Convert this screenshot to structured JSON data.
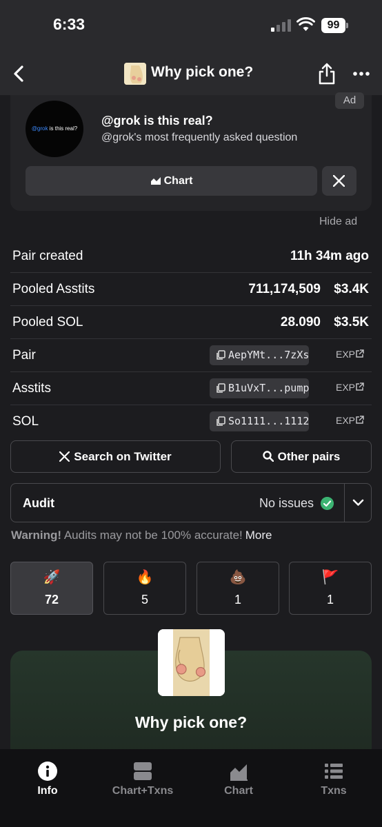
{
  "status_bar": {
    "time": "6:33",
    "battery": "99"
  },
  "header": {
    "title": "Why pick one?"
  },
  "ad": {
    "badge": "Ad",
    "logo_handle": "@grok",
    "logo_text": " is this real?",
    "title": "@grok is this real?",
    "subtitle": "@grok's most frequently asked question",
    "chart_button": "Chart",
    "hide_label": "Hide ad"
  },
  "info": {
    "pair_created": {
      "label": "Pair created",
      "value": "11h 34m ago"
    },
    "pooled_token": {
      "label": "Pooled Asstits",
      "amount": "711,174,509",
      "usd": "$3.4K"
    },
    "pooled_sol": {
      "label": "Pooled SOL",
      "amount": "28.090",
      "usd": "$3.5K"
    },
    "addresses": [
      {
        "label": "Pair",
        "address": "AepYMt...7zXs",
        "exp": "EXP"
      },
      {
        "label": "Asstits",
        "address": "B1uVxT...pump",
        "exp": "EXP"
      },
      {
        "label": "SOL",
        "address": "So1111...1112",
        "exp": "EXP"
      }
    ]
  },
  "actions": {
    "twitter": "Search on Twitter",
    "other_pairs": "Other pairs"
  },
  "audit": {
    "label": "Audit",
    "status": "No issues",
    "warning_bold": "Warning!",
    "warning_text": " Audits may not be 100% accurate!",
    "more": "More"
  },
  "votes": [
    {
      "emoji": "🚀",
      "icon": "rocket-icon",
      "count": "72"
    },
    {
      "emoji": "🔥",
      "icon": "fire-icon",
      "count": "5"
    },
    {
      "emoji": "💩",
      "icon": "poop-icon",
      "count": "1"
    },
    {
      "emoji": "🚩",
      "icon": "flag-icon",
      "count": "1"
    }
  ],
  "token": {
    "name": "Why pick one?"
  },
  "tabs": [
    {
      "label": "Info"
    },
    {
      "label": "Chart+Txns"
    },
    {
      "label": "Chart"
    },
    {
      "label": "Txns"
    }
  ],
  "colors": {
    "background": "#1c1c1f",
    "card": "#242427",
    "success": "#3cb372",
    "banner": "#26362b"
  }
}
